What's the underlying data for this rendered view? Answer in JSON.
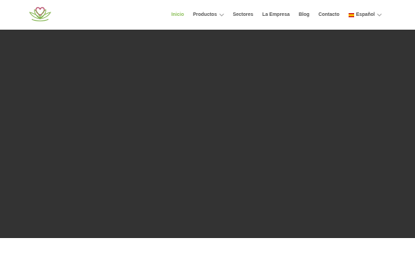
{
  "header": {
    "logo_icon": "lotus-heart-logo",
    "nav": [
      {
        "label": "Inicio",
        "active": true
      },
      {
        "label": "Productos",
        "has_dropdown": true
      },
      {
        "label": "Sectores"
      },
      {
        "label": "La Empresa"
      },
      {
        "label": "Blog"
      },
      {
        "label": "Contacto"
      },
      {
        "label": "Español",
        "has_dropdown": true,
        "icon": "spain-flag-icon"
      }
    ]
  },
  "colors": {
    "accent": "#8cc05a",
    "nav_text": "#555555",
    "hero_background": "#333333",
    "header_background": "#ffffff"
  }
}
